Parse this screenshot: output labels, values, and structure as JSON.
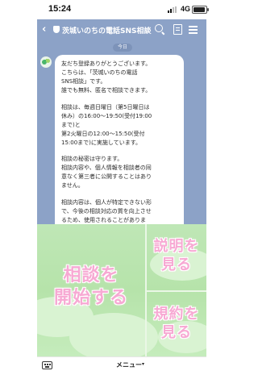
{
  "status_bar": {
    "time": "15:24",
    "network": "4G",
    "battery_level": 0.85
  },
  "header": {
    "back_icon": "chevron-left-icon",
    "account_icon": "shield-icon",
    "title": "茨城いのちの電話SNS相談",
    "icons": [
      "search-icon",
      "notes-icon",
      "menu-icon"
    ],
    "text_color": "#ffffff",
    "background": "#8ca2c7"
  },
  "chat": {
    "date_label": "今日",
    "message": {
      "paragraphs": [
        "友だち登録ありがとうございます。\nこちらは、「茨城いのちの電話\nSNS相談」です。\n誰でも無料、匿名で相談できます。",
        "相談は、毎週日曜日（第5日曜日は\n休み）の16:00〜19:50(受付19:00\nまで)と\n第2火曜日の12:00〜15:50(受付\n15:00まで)に実施しています。",
        "相談の秘密は守ります。\n相談内容や、個人情報を相談者の同\n意なく第三者に公開することはあり\nません。",
        "相談内容は、個人が特定できない形\nで、今後の相談対応の質を向上させ\nるため、使用されることがありま\nす。"
      ]
    }
  },
  "rich_menu": {
    "start_label": "相談を\n開始する",
    "explain_label": "説明を\n見る",
    "terms_label": "規約を\n見る",
    "text_color": "#f7a9d3",
    "background": "#bfe7b6"
  },
  "bottom_bar": {
    "keyboard_icon": "keyboard-icon",
    "menu_label": "メニュー",
    "menu_caret": "▾"
  }
}
